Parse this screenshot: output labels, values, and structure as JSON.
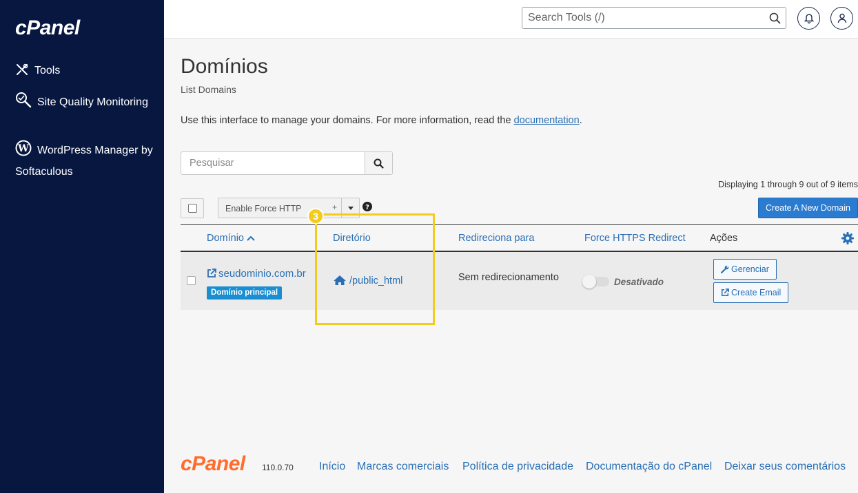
{
  "sidebar": {
    "logo": "cPanel",
    "items": [
      {
        "label": "Tools",
        "icon": "tools-icon"
      },
      {
        "label": "Site Quality Monitoring",
        "icon": "site-quality-icon"
      },
      {
        "label": "WordPress Manager by Softaculous",
        "icon": "wordpress-icon"
      }
    ]
  },
  "header": {
    "search_placeholder": "Search Tools (/)",
    "icons": [
      "search-icon",
      "bell-icon",
      "user-icon"
    ]
  },
  "main": {
    "title": "Domínios",
    "subtitle": "List Domains",
    "intro_text": "Use this interface to manage your domains. For more information, read the ",
    "intro_link": "documentation",
    "intro_end": ".",
    "filter_placeholder": "Pesquisar",
    "displaying": "Displaying 1 through 9 out of 9 items",
    "bulk_action": "Enable Force HTTP",
    "bulk_plus": "+",
    "create_button": "Create A New Domain",
    "columns": {
      "domain": "Domínio",
      "directory": "Diretório",
      "redirect": "Redireciona para",
      "force_https": "Force HTTPS Redirect",
      "actions": "Ações"
    },
    "rows": [
      {
        "domain": "seudominio.com.br",
        "badge": "Domínio principal",
        "directory": "/public_html",
        "redirect": "Sem redirecionamento",
        "force_https": "Desativado",
        "force_https_on": false,
        "actions": [
          "Gerenciar",
          "Create Email"
        ]
      }
    ]
  },
  "annotation": {
    "step": "3",
    "color": "#f2cb1d"
  },
  "footer": {
    "logo": "cPanel",
    "version": "110.0.70",
    "links": [
      "Início",
      "Marcas comerciais",
      "Política de privacidade",
      "Documentação do cPanel",
      "Deixar seus comentários"
    ]
  }
}
